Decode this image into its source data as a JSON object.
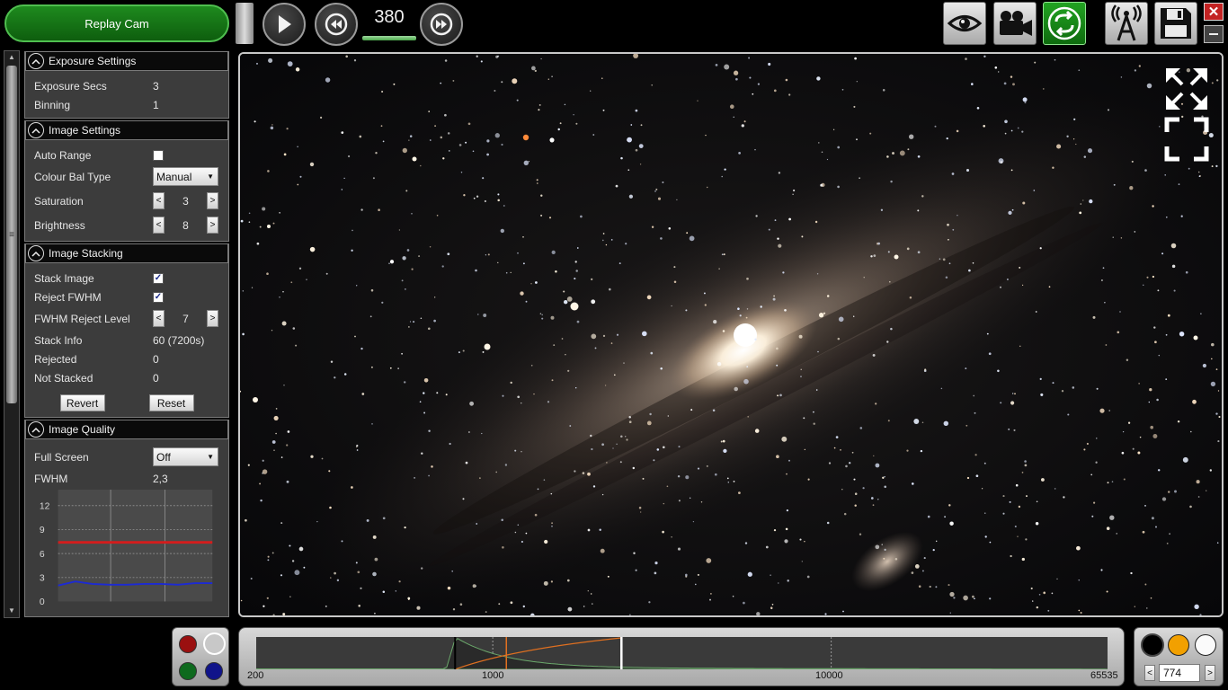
{
  "toolbar": {
    "replay_label": "Replay Cam",
    "frame_number": "380",
    "frame_progress": 1.0,
    "icons": [
      "play-icon",
      "rewind-icon",
      "fast-forward-icon",
      "eye-icon",
      "video-camera-icon",
      "loop-icon",
      "broadcast-antenna-icon",
      "save-icon",
      "close-icon",
      "minimize-icon"
    ]
  },
  "panel": {
    "exposure": {
      "title": "Exposure Settings",
      "rows": [
        {
          "label": "Exposure Secs",
          "value": "3"
        },
        {
          "label": "Binning",
          "value": "1"
        }
      ]
    },
    "image_settings": {
      "title": "Image Settings",
      "auto_range_label": "Auto Range",
      "auto_range_checked": false,
      "colour_bal_label": "Colour Bal Type",
      "colour_bal_value": "Manual",
      "saturation_label": "Saturation",
      "saturation_value": "3",
      "brightness_label": "Brightness",
      "brightness_value": "8"
    },
    "stacking": {
      "title": "Image Stacking",
      "stack_image_label": "Stack Image",
      "stack_image_checked": true,
      "reject_fwhm_label": "Reject FWHM",
      "reject_fwhm_checked": true,
      "fwhm_reject_label": "FWHM Reject Level",
      "fwhm_reject_value": "7",
      "stack_info_label": "Stack Info",
      "stack_info_value": "60 (7200s)",
      "rejected_label": "Rejected",
      "rejected_value": "0",
      "not_stacked_label": "Not Stacked",
      "not_stacked_value": "0",
      "revert_label": "Revert",
      "reset_label": "Reset"
    },
    "quality": {
      "title": "Image Quality",
      "full_screen_label": "Full Screen",
      "full_screen_value": "Off",
      "fwhm_label": "FWHM",
      "fwhm_value": "2,3"
    }
  },
  "chart_data": [
    {
      "type": "line",
      "yticks": [
        "12",
        "9",
        "6",
        "3",
        "0"
      ],
      "ylim": [
        0,
        14
      ],
      "series": [
        {
          "color": "#d41c1c",
          "values": [
            7.4,
            7.4,
            7.4,
            7.4,
            7.4,
            7.4,
            7.4,
            7.4,
            7.4,
            7.4
          ]
        },
        {
          "color": "#1c2ad4",
          "values": [
            2.0,
            2.5,
            2.2,
            2.1,
            2.1,
            2.2,
            2.2,
            2.1,
            2.3,
            2.3
          ]
        }
      ]
    },
    {
      "type": "area",
      "x_scale": "log",
      "x_ticks": [
        "200",
        "1000",
        "10000",
        "65535"
      ],
      "black_point": 774,
      "curve_marker": 2400
    }
  ],
  "histogram": {
    "label_min": "200",
    "label_1k": "1000",
    "label_10k": "10000",
    "label_max": "65535"
  },
  "points": {
    "value": "774",
    "prev": "<",
    "next": ">"
  },
  "stepper": {
    "prev": "<",
    "next": ">"
  },
  "colors": {
    "accent_green": "#1e8a1e",
    "close_red": "#c32323",
    "fwhm_limit": "#d41c1c",
    "fwhm_series": "#1c2ad4"
  }
}
